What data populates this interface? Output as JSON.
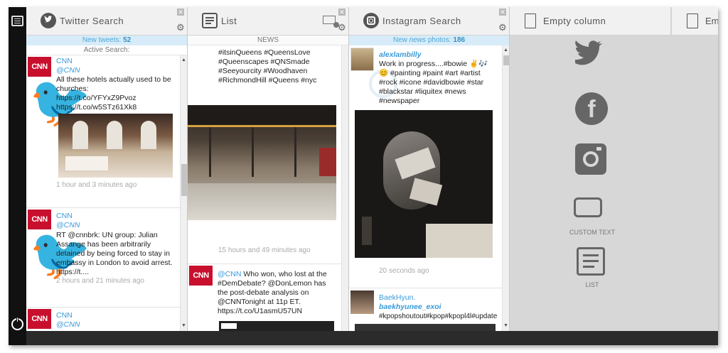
{
  "colors": {
    "accent": "#3a9ad9",
    "cnn": "#c8102e",
    "dark": "#111111"
  },
  "columns": {
    "twitter": {
      "title": "Twitter Search",
      "new_label": "New tweets:",
      "new_count": "52",
      "subheader": "Active Search:",
      "tweets": [
        {
          "name": "CNN",
          "handle": "@CNN",
          "text": "All these hotels actually used to be churches:\nhttps://t.co/YFYxZ9Pvoz\nhttps://t.co/w5STz61Xk8",
          "time": "1 hour and 3 minutes ago",
          "avatar": "CNN"
        },
        {
          "name": "CNN",
          "handle": "@CNN",
          "text": "RT @cnnbrk: UN group: Julian Assange has been arbitrarily detained by being forced to stay in embassy in London to avoid arrest. https://t....",
          "time": "2 hours and 21 minutes ago",
          "avatar": "CNN"
        },
        {
          "name": "CNN",
          "handle": "@CNN",
          "text": "",
          "time": "",
          "avatar": "CNN"
        }
      ]
    },
    "list": {
      "title": "List",
      "subheader": "NEWS",
      "hashtags": "#itsinQueens #QueensLove\n#Queenscapes #QNSmade\n#Seeyourcity #Woodhaven\n#RichmondHill #Queens #nyc",
      "time1": "15 hours and 49 minutes ago",
      "tweet2_handle": "@CNN",
      "tweet2_text": "Who won, who lost at the #DemDebate? @DonLemon has the post-debate analysis on @CNNTonight at 11p ET. https://t.co/U1asmU57UN",
      "avatar": "CNN"
    },
    "instagram": {
      "title": "Instagram Search",
      "new_label": "New",
      "new_label_em": "news",
      "new_label_tail": "photos:",
      "new_count": "186",
      "post1": {
        "user": "alexlambilly",
        "text": "Work in progress....#bowie ✌🎶\n😊 #painting #paint #art #artist\n#rock #icone #davidbowie #star\n#blackstar #liquitex #news\n#newspaper",
        "time": "20 seconds ago"
      },
      "post2": {
        "user": "BaekHyun.",
        "handle": "baekhyunee_exoi",
        "text": "#kpopshoutout#kpop#kpopl4l#update"
      }
    },
    "empty": {
      "title": "Empty column",
      "title2": "Em"
    }
  },
  "palette": {
    "custom_text": "CUSTOM TEXT",
    "list": "LIST"
  }
}
